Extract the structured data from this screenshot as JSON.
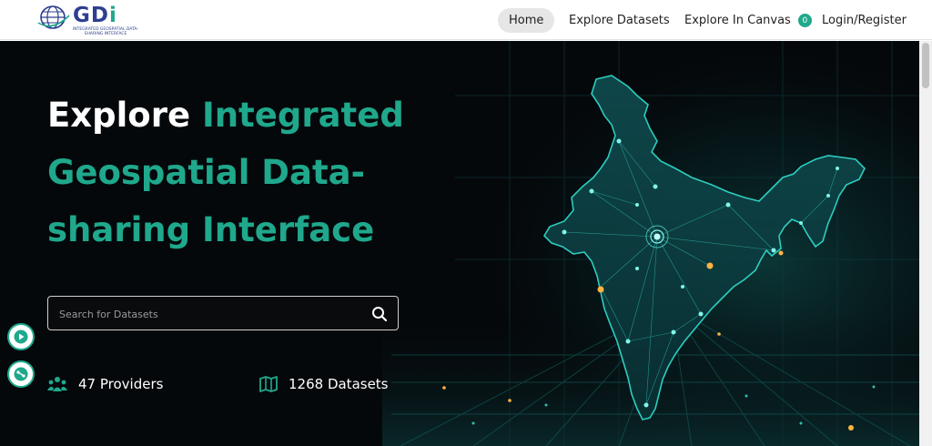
{
  "brand": {
    "name": "GD",
    "name_i": "i",
    "subtitle": "INTEGRATED GEOSPATIAL DATA-SHARING INTERFACE"
  },
  "nav": {
    "home": "Home",
    "explore_datasets": "Explore Datasets",
    "explore_canvas": "Explore In Canvas",
    "canvas_count": "0",
    "login": "Login/Register"
  },
  "hero": {
    "headline_white": "Explore ",
    "headline_accent": "Integrated Geospatial Data-sharing Interface"
  },
  "search": {
    "placeholder": "Search for Datasets"
  },
  "stats": {
    "providers": "47 Providers",
    "datasets": "1268 Datasets"
  },
  "colors": {
    "accent": "#1fa88c",
    "brand": "#2d3f8f",
    "hero_bg": "#05080b"
  },
  "icons": {
    "search": "search-icon",
    "providers": "people-group-icon",
    "datasets": "map-icon",
    "play": "play-icon",
    "share": "share-icon"
  }
}
